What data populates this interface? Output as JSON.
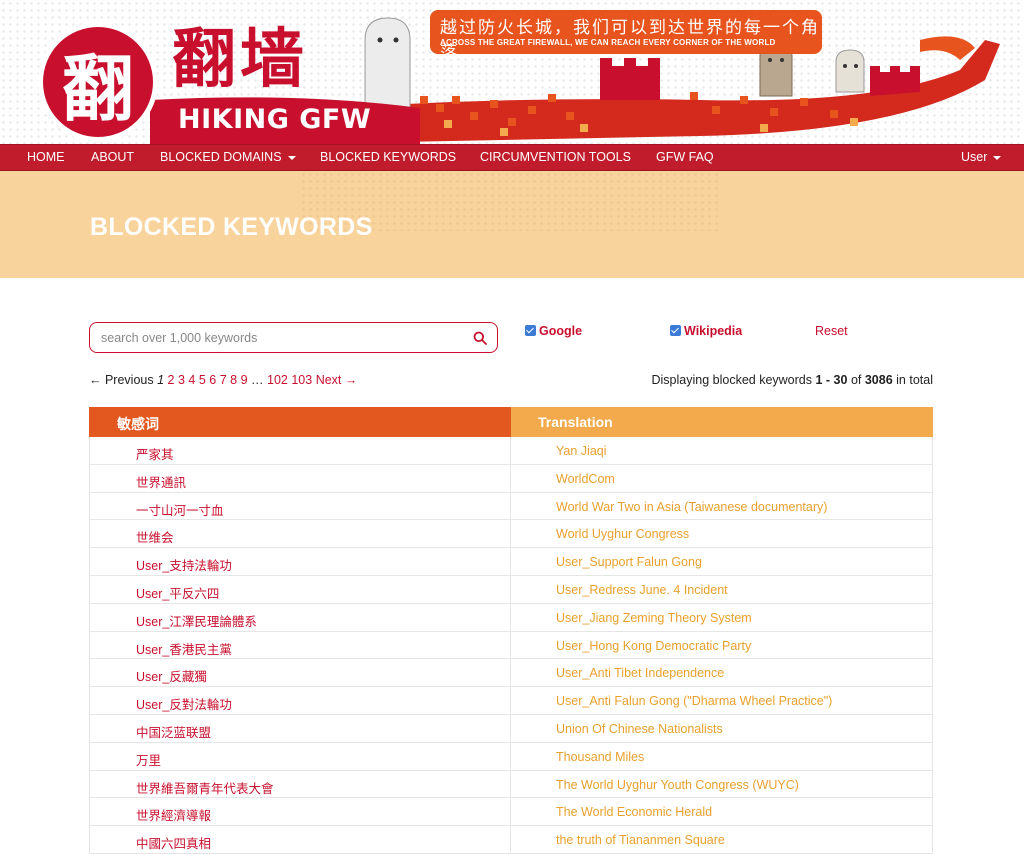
{
  "banner": {
    "logo_glyph": "翻",
    "brand_cn": "翻墙",
    "brand_en": "HIKING GFW",
    "slogan_cn": "越过防火长城，我们可以到达世界的每一个角落",
    "slogan_en": "ACROSS THE GREAT FIREWALL, WE CAN REACH EVERY CORNER OF THE WORLD"
  },
  "nav": {
    "items": [
      "HOME",
      "ABOUT",
      "BLOCKED DOMAINS",
      "BLOCKED KEYWORDS",
      "CIRCUMVENTION TOOLS",
      "GFW FAQ"
    ],
    "user": "User"
  },
  "hero": {
    "title": "BLOCKED KEYWORDS"
  },
  "search": {
    "placeholder": "search over 1,000 keywords"
  },
  "filters": {
    "google": "Google",
    "wikipedia": "Wikipedia",
    "reset": "Reset"
  },
  "pager": {
    "previous": "← Previous",
    "current": "1",
    "pages": [
      "2",
      "3",
      "4",
      "5",
      "6",
      "7",
      "8",
      "9"
    ],
    "ellipsis": "…",
    "last_pages": [
      "102",
      "103"
    ],
    "next": "Next →"
  },
  "display": {
    "prefix": "Displaying blocked keywords",
    "range": "1 - 30",
    "of": "of",
    "total": "3086",
    "suffix": "in total"
  },
  "table": {
    "headers": [
      "敏感词",
      "Translation"
    ],
    "rows": [
      [
        "严家其",
        "Yan Jiaqi"
      ],
      [
        "世界通訊",
        "WorldCom"
      ],
      [
        "一寸山河一寸血",
        "World War Two in Asia (Taiwanese documentary)"
      ],
      [
        "世维会",
        "World Uyghur Congress"
      ],
      [
        "User_支持法輪功",
        "User_Support Falun Gong"
      ],
      [
        "User_平反六四",
        "User_Redress June. 4 Incident"
      ],
      [
        "User_江澤民理論體系",
        "User_Jiang Zeming Theory System"
      ],
      [
        "User_香港民主黨",
        "User_Hong Kong Democratic Party"
      ],
      [
        "User_反藏獨",
        "User_Anti Tibet Independence"
      ],
      [
        "User_反對法輪功",
        "User_Anti Falun Gong (\"Dharma Wheel Practice\")"
      ],
      [
        "中国泛蓝联盟",
        "Union Of Chinese Nationalists"
      ],
      [
        "万里",
        "Thousand Miles"
      ],
      [
        "世界維吾爾青年代表大會",
        "The World Uyghur Youth Congress (WUYC)"
      ],
      [
        "世界經濟導報",
        "The World Economic Herald"
      ],
      [
        "中國六四真相",
        "the truth of Tiananmen Square"
      ]
    ]
  },
  "colors": {
    "brand_red": "#c8102e",
    "nav_red": "#c01c2b",
    "hero_bg": "#f8d39c",
    "header_orange": "#e2581f",
    "header_amber": "#f3aa4c",
    "translation_text": "#e9a02d"
  }
}
